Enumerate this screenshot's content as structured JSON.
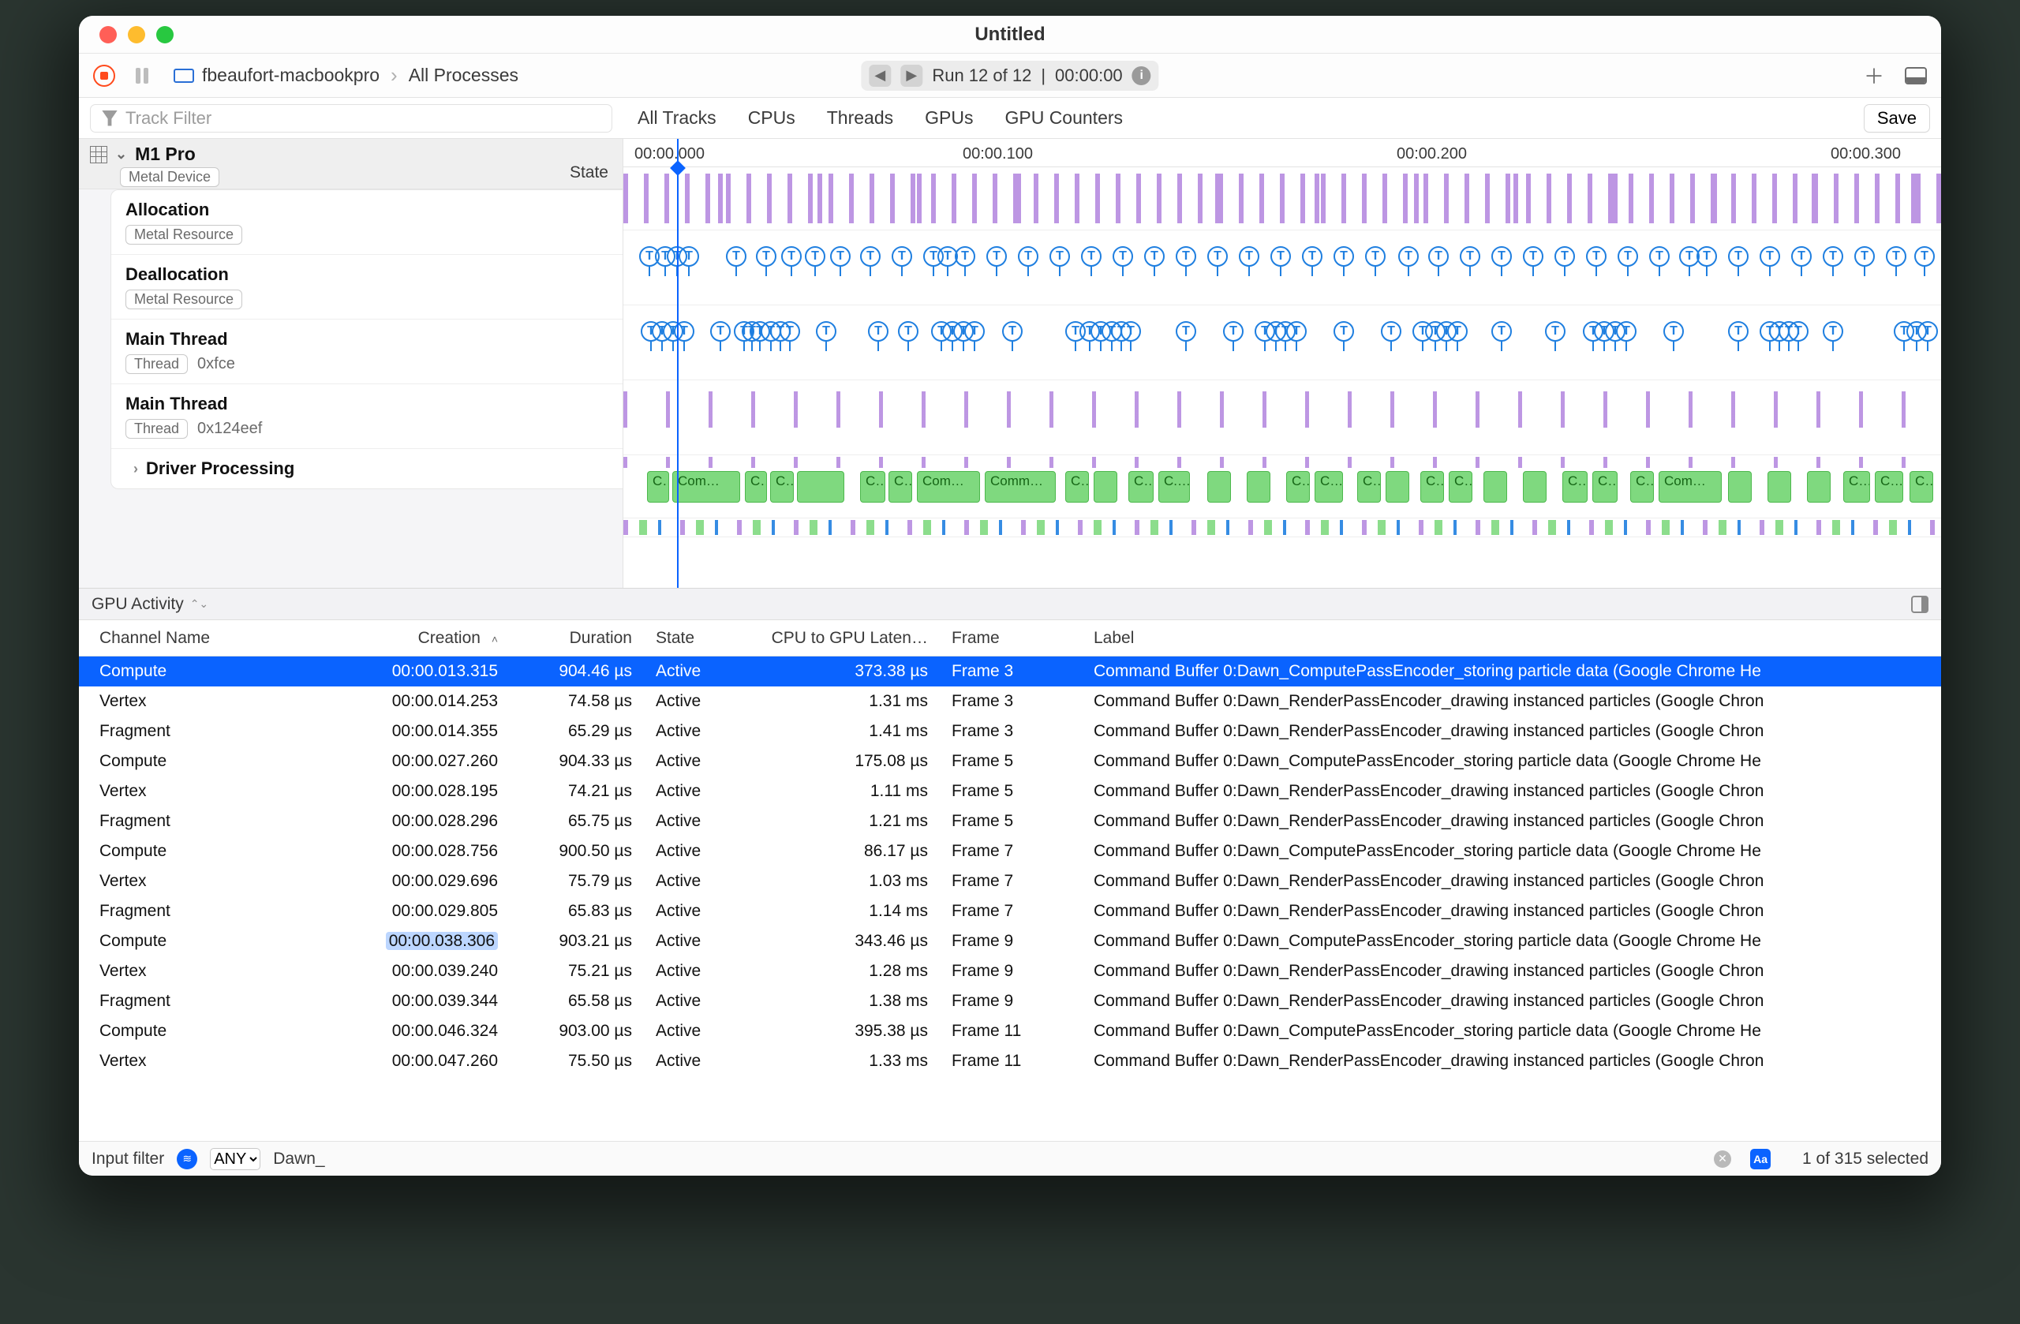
{
  "window": {
    "title": "Untitled"
  },
  "toolbar": {
    "breadcrumb_host": "fbeaufort-macbookpro",
    "breadcrumb_target": "All Processes",
    "run_label": "Run 12 of 12",
    "run_time": "00:00:00",
    "plus_glyph": "＋"
  },
  "filter": {
    "placeholder": "Track Filter",
    "tabs": [
      "All Tracks",
      "CPUs",
      "Threads",
      "GPUs",
      "GPU Counters"
    ],
    "save_label": "Save"
  },
  "ruler": {
    "ticks": [
      "00:00.000",
      "00:00.100",
      "00:00.200",
      "00:00.300"
    ]
  },
  "sidebar": {
    "state_label": "State",
    "device_name": "M1 Pro",
    "device_badge": "Metal Device",
    "items": [
      {
        "title": "Allocation",
        "badge": "Metal Resource"
      },
      {
        "title": "Deallocation",
        "badge": "Metal Resource"
      },
      {
        "title": "Main Thread",
        "badge": "Thread",
        "extra": "0xfce"
      },
      {
        "title": "Main Thread",
        "badge": "Thread",
        "extra": "0x124eef"
      }
    ],
    "driver": "Driver Processing"
  },
  "green_blocks": [
    {
      "l": 30,
      "w": 28,
      "t": "C…"
    },
    {
      "l": 62,
      "w": 86,
      "t": "Com…"
    },
    {
      "l": 154,
      "w": 28,
      "t": "C…"
    },
    {
      "l": 186,
      "w": 30,
      "t": "C…"
    },
    {
      "l": 220,
      "w": 60,
      "t": ""
    },
    {
      "l": 300,
      "w": 32,
      "t": "C…"
    },
    {
      "l": 336,
      "w": 30,
      "t": "C…"
    },
    {
      "l": 372,
      "w": 80,
      "t": "Com…"
    },
    {
      "l": 458,
      "w": 90,
      "t": "Comm…"
    },
    {
      "l": 560,
      "w": 30,
      "t": "C…"
    },
    {
      "l": 596,
      "w": 30,
      "t": ""
    },
    {
      "l": 640,
      "w": 32,
      "t": "C…"
    },
    {
      "l": 678,
      "w": 40,
      "t": "C.…"
    },
    {
      "l": 740,
      "w": 30,
      "t": ""
    },
    {
      "l": 790,
      "w": 30,
      "t": ""
    },
    {
      "l": 840,
      "w": 30,
      "t": "C…"
    },
    {
      "l": 876,
      "w": 36,
      "t": "C…"
    },
    {
      "l": 930,
      "w": 30,
      "t": "C…"
    },
    {
      "l": 966,
      "w": 30,
      "t": ""
    },
    {
      "l": 1010,
      "w": 30,
      "t": "C…"
    },
    {
      "l": 1046,
      "w": 30,
      "t": "C…"
    },
    {
      "l": 1090,
      "w": 30,
      "t": ""
    },
    {
      "l": 1140,
      "w": 30,
      "t": ""
    },
    {
      "l": 1190,
      "w": 32,
      "t": "C…"
    },
    {
      "l": 1228,
      "w": 32,
      "t": "C…"
    },
    {
      "l": 1276,
      "w": 30,
      "t": "C…"
    },
    {
      "l": 1312,
      "w": 80,
      "t": "Com…"
    },
    {
      "l": 1400,
      "w": 30,
      "t": ""
    },
    {
      "l": 1450,
      "w": 30,
      "t": ""
    },
    {
      "l": 1500,
      "w": 30,
      "t": ""
    },
    {
      "l": 1546,
      "w": 34,
      "t": "C…"
    },
    {
      "l": 1586,
      "w": 36,
      "t": "C…"
    },
    {
      "l": 1630,
      "w": 30,
      "t": "C…"
    }
  ],
  "alloc_markers_x": [
    20,
    40,
    55,
    70,
    130,
    168,
    200,
    230,
    262,
    300,
    340,
    380,
    398,
    420,
    460,
    500,
    540,
    580,
    620,
    660,
    700,
    740,
    780,
    820,
    860,
    900,
    940,
    982,
    1020,
    1060,
    1100,
    1140,
    1180,
    1220,
    1260,
    1300,
    1338,
    1360,
    1400,
    1440,
    1480,
    1520,
    1560,
    1600,
    1636
  ],
  "dealloc_markers_x": [
    22,
    36,
    50,
    64,
    110,
    140,
    150,
    160,
    174,
    186,
    198,
    244,
    310,
    348,
    390,
    404,
    418,
    432,
    480,
    560,
    578,
    592,
    606,
    618,
    630,
    700,
    760,
    800,
    814,
    826,
    840,
    900,
    960,
    1000,
    1016,
    1030,
    1044,
    1100,
    1168,
    1216,
    1230,
    1244,
    1258,
    1318,
    1400,
    1440,
    1452,
    1464,
    1476,
    1520,
    1610,
    1626,
    1640
  ],
  "activity": {
    "label": "GPU Activity"
  },
  "columns": {
    "channel": "Channel Name",
    "creation": "Creation",
    "duration": "Duration",
    "state": "State",
    "latency": "CPU to GPU Laten…",
    "frame": "Frame",
    "label": "Label"
  },
  "rows": [
    {
      "sel": true,
      "hl": false,
      "channel": "Compute",
      "creation": "00:00.013.315",
      "duration": "904.46 µs",
      "state": "Active",
      "latency": "373.38 µs",
      "frame": "Frame 3",
      "label": "Command Buffer 0:Dawn_ComputePassEncoder_storing particle data   (Google Chrome He"
    },
    {
      "sel": false,
      "hl": false,
      "channel": "Vertex",
      "creation": "00:00.014.253",
      "duration": "74.58 µs",
      "state": "Active",
      "latency": "1.31 ms",
      "frame": "Frame 3",
      "label": "Command Buffer 0:Dawn_RenderPassEncoder_drawing instanced particles   (Google Chron"
    },
    {
      "sel": false,
      "hl": false,
      "channel": "Fragment",
      "creation": "00:00.014.355",
      "duration": "65.29 µs",
      "state": "Active",
      "latency": "1.41 ms",
      "frame": "Frame 3",
      "label": "Command Buffer 0:Dawn_RenderPassEncoder_drawing instanced particles   (Google Chron"
    },
    {
      "sel": false,
      "hl": false,
      "channel": "Compute",
      "creation": "00:00.027.260",
      "duration": "904.33 µs",
      "state": "Active",
      "latency": "175.08 µs",
      "frame": "Frame 5",
      "label": "Command Buffer 0:Dawn_ComputePassEncoder_storing particle data   (Google Chrome He"
    },
    {
      "sel": false,
      "hl": false,
      "channel": "Vertex",
      "creation": "00:00.028.195",
      "duration": "74.21 µs",
      "state": "Active",
      "latency": "1.11 ms",
      "frame": "Frame 5",
      "label": "Command Buffer 0:Dawn_RenderPassEncoder_drawing instanced particles   (Google Chron"
    },
    {
      "sel": false,
      "hl": false,
      "channel": "Fragment",
      "creation": "00:00.028.296",
      "duration": "65.75 µs",
      "state": "Active",
      "latency": "1.21 ms",
      "frame": "Frame 5",
      "label": "Command Buffer 0:Dawn_RenderPassEncoder_drawing instanced particles   (Google Chron"
    },
    {
      "sel": false,
      "hl": false,
      "channel": "Compute",
      "creation": "00:00.028.756",
      "duration": "900.50 µs",
      "state": "Active",
      "latency": "86.17 µs",
      "frame": "Frame 7",
      "label": "Command Buffer 0:Dawn_ComputePassEncoder_storing particle data   (Google Chrome He"
    },
    {
      "sel": false,
      "hl": false,
      "channel": "Vertex",
      "creation": "00:00.029.696",
      "duration": "75.79 µs",
      "state": "Active",
      "latency": "1.03 ms",
      "frame": "Frame 7",
      "label": "Command Buffer 0:Dawn_RenderPassEncoder_drawing instanced particles   (Google Chron"
    },
    {
      "sel": false,
      "hl": false,
      "channel": "Fragment",
      "creation": "00:00.029.805",
      "duration": "65.83 µs",
      "state": "Active",
      "latency": "1.14 ms",
      "frame": "Frame 7",
      "label": "Command Buffer 0:Dawn_RenderPassEncoder_drawing instanced particles   (Google Chron"
    },
    {
      "sel": false,
      "hl": true,
      "channel": "Compute",
      "creation": "00:00.038.306",
      "duration": "903.21 µs",
      "state": "Active",
      "latency": "343.46 µs",
      "frame": "Frame 9",
      "label": "Command Buffer 0:Dawn_ComputePassEncoder_storing particle data   (Google Chrome He"
    },
    {
      "sel": false,
      "hl": false,
      "channel": "Vertex",
      "creation": "00:00.039.240",
      "duration": "75.21 µs",
      "state": "Active",
      "latency": "1.28 ms",
      "frame": "Frame 9",
      "label": "Command Buffer 0:Dawn_RenderPassEncoder_drawing instanced particles   (Google Chron"
    },
    {
      "sel": false,
      "hl": false,
      "channel": "Fragment",
      "creation": "00:00.039.344",
      "duration": "65.58 µs",
      "state": "Active",
      "latency": "1.38 ms",
      "frame": "Frame 9",
      "label": "Command Buffer 0:Dawn_RenderPassEncoder_drawing instanced particles   (Google Chron"
    },
    {
      "sel": false,
      "hl": false,
      "channel": "Compute",
      "creation": "00:00.046.324",
      "duration": "903.00 µs",
      "state": "Active",
      "latency": "395.38 µs",
      "frame": "Frame 11",
      "label": "Command Buffer 0:Dawn_ComputePassEncoder_storing particle data   (Google Chrome He"
    },
    {
      "sel": false,
      "hl": false,
      "channel": "Vertex",
      "creation": "00:00.047.260",
      "duration": "75.50 µs",
      "state": "Active",
      "latency": "1.33 ms",
      "frame": "Frame 11",
      "label": "Command Buffer 0:Dawn_RenderPassEncoder_drawing instanced particles   (Google Chron"
    }
  ],
  "footer": {
    "input_label": "Input filter",
    "mode": "ANY",
    "query": "Dawn_",
    "selection": "1 of 315 selected"
  }
}
